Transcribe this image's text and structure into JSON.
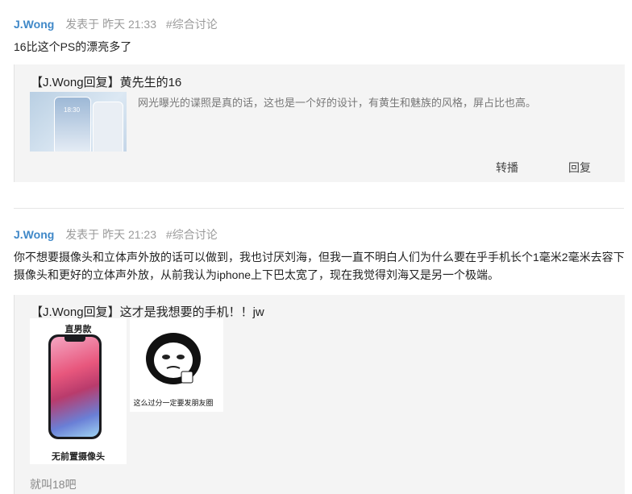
{
  "posts": [
    {
      "author": "J.Wong",
      "posted": "发表于 昨天 21:33",
      "topic": "#综合讨论",
      "content": "16比这个PS的漂亮多了",
      "quote": {
        "title": "【J.Wong回复】黄先生的16",
        "desc": "网光曝光的谍照是真的话，这也是一个好的设计，有黄生和魅族的风格，屏占比也高。",
        "thumb_clock": "18:30",
        "actions": {
          "repost": "转播",
          "reply": "回复"
        }
      }
    },
    {
      "author": "J.Wong",
      "posted": "发表于 昨天 21:23",
      "topic": "#综合讨论",
      "content_line1": "你不想要摄像头和立体声外放的话可以做到，我也讨厌刘海，但我一直不明白人们为什么要在乎手机长个1毫米2毫米去容下",
      "content_line2": "摄像头和更好的立体声外放，从前我认为iphone上下巴太宽了，现在我觉得刘海又是另一个极端。",
      "quote": {
        "title": "【J.Wong回复】这才是我想要的手机！！jw",
        "image1_top_caption": "直男款",
        "image1_bottom_caption": "无前置摄像头",
        "image2_caption": "这么过分一定要发朋友圈",
        "footer": "就叫18吧"
      }
    }
  ],
  "colors": {
    "author": "#3f88c8",
    "meta": "#9a9a9a",
    "quote_bg": "#f4f4f4"
  }
}
